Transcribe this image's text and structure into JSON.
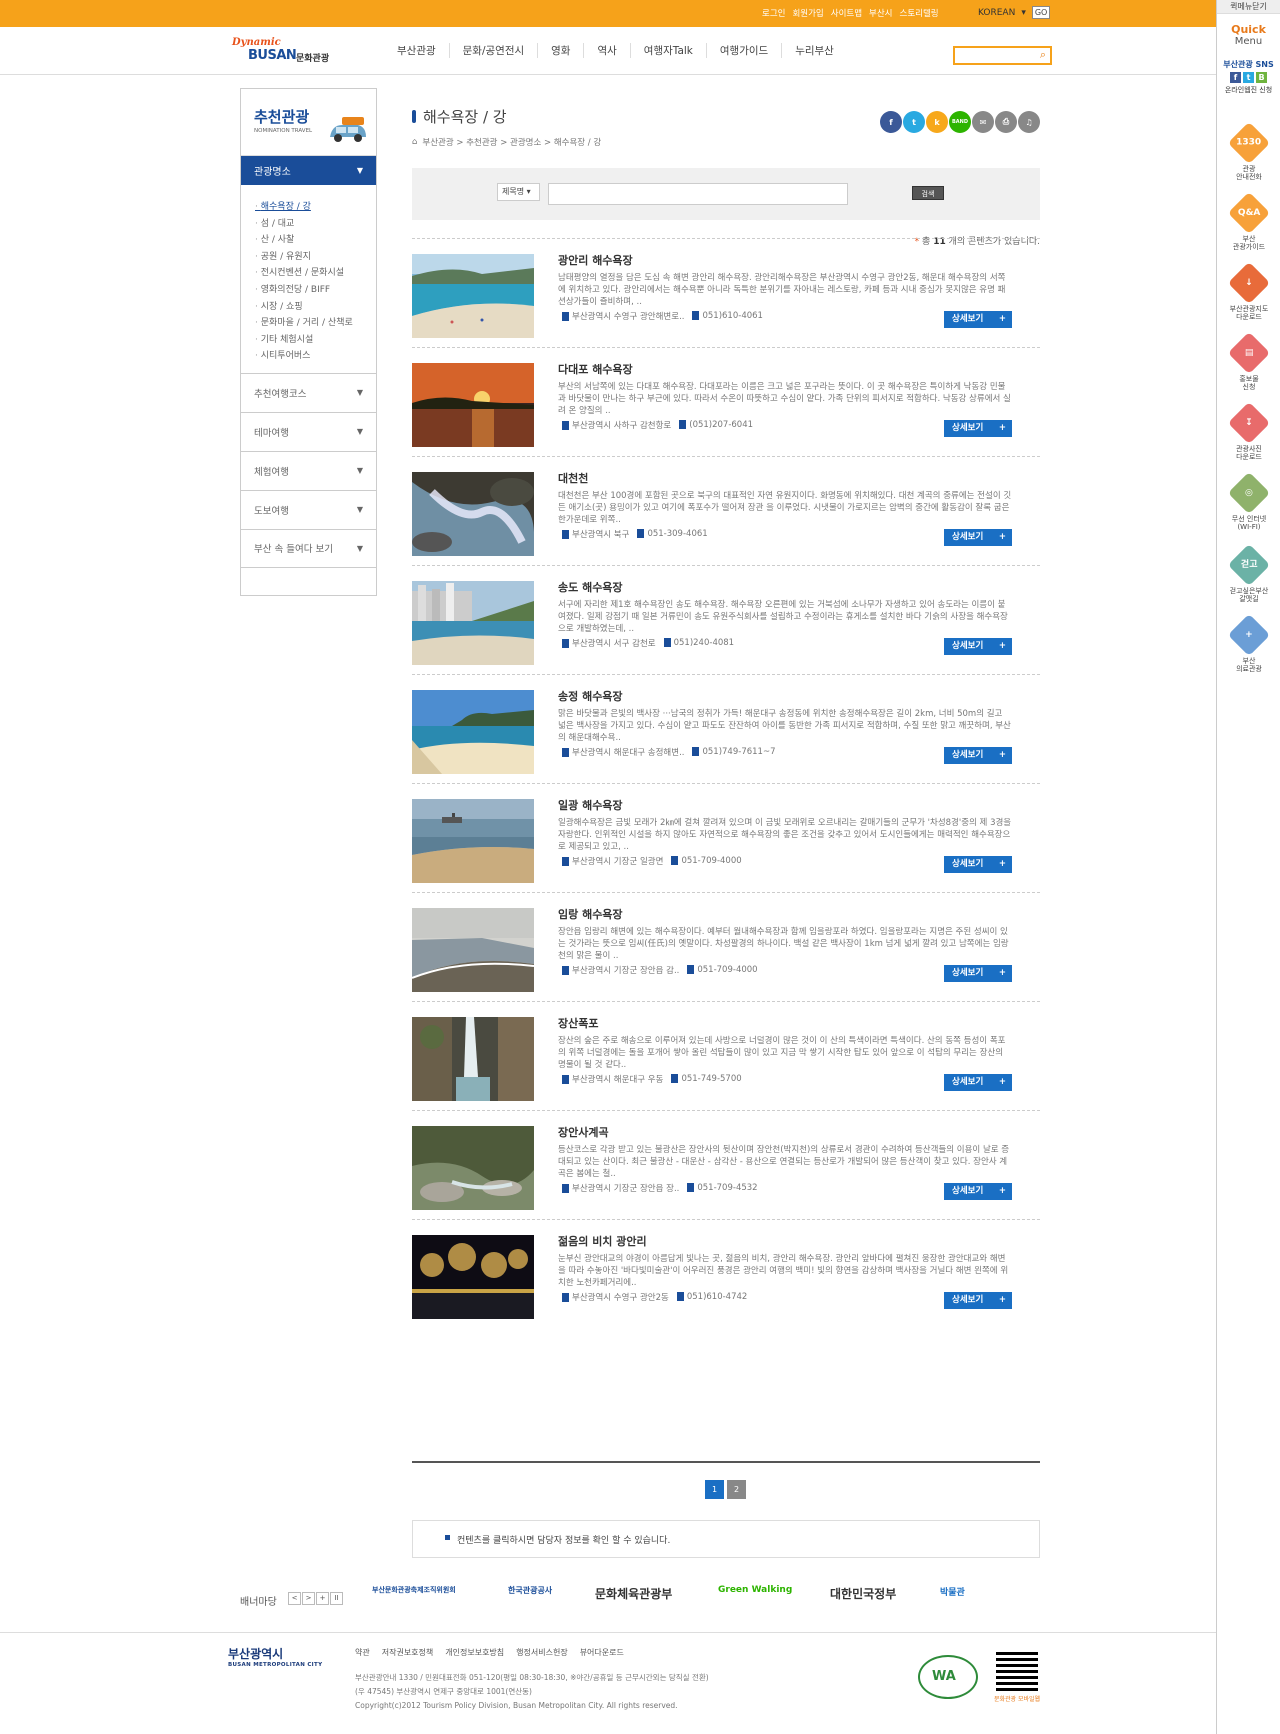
{
  "top": {
    "links": [
      "로그인",
      "회원가입",
      "사이트맵",
      "부산시",
      "스토리텔링"
    ],
    "lang": "KOREAN",
    "go": "GO"
  },
  "header": {
    "logo_dynamic": "Dynamic",
    "logo_busan": "BUSAN",
    "logo_kr": "문화관광",
    "nav": [
      "부산관광",
      "문화/공연전시",
      "영화",
      "역사",
      "여행자Talk",
      "여행가이드",
      "누리부산"
    ]
  },
  "quick": {
    "close": "퀵메뉴닫기",
    "title1": "Quick",
    "title2": "Menu",
    "sns": "부산관광 SNS",
    "news": "온라인웹진 신청",
    "items": [
      {
        "icon": "1330",
        "label1": "관광",
        "label2": "안내전화",
        "color": "#f7a13a"
      },
      {
        "icon": "Q&A",
        "label1": "부산",
        "label2": "관광가이드",
        "color": "#f7a13a"
      },
      {
        "icon": "↓",
        "label1": "부산관광지도",
        "label2": "다운로드",
        "color": "#e86b3a"
      },
      {
        "icon": "▤",
        "label1": "홍보물",
        "label2": "신청",
        "color": "#e86b6b"
      },
      {
        "icon": "↧",
        "label1": "관광사진",
        "label2": "다운로드",
        "color": "#e86b6b"
      },
      {
        "icon": "◎",
        "label1": "무선 인터넷",
        "label2": "(WI-FI)",
        "color": "#8fb26b"
      },
      {
        "icon": "걷고",
        "label1": "걷고싶은부산",
        "label2": "갈맷길",
        "color": "#6bb2a6"
      },
      {
        "icon": "+",
        "label1": "부산",
        "label2": "의료관광",
        "color": "#6b9ed6"
      }
    ]
  },
  "lnb": {
    "title": "추천관광",
    "subtitle": "NOMINATION TRAVEL",
    "active": "관광명소",
    "sub": [
      "해수욕장 / 강",
      "섬 / 대교",
      "산 / 사찰",
      "공원 / 유원지",
      "전시컨벤션 / 문화시설",
      "영화의전당 / BIFF",
      "시장 / 쇼핑",
      "문화마을 / 거리 / 산책로",
      "기타 체험시설",
      "시티투어버스"
    ],
    "groups": [
      "추천여행코스",
      "테마여행",
      "체험여행",
      "도보여행",
      "부산 속 들여다 보기"
    ]
  },
  "main": {
    "title": "해수욕장 / 강",
    "breadcrumb": "부산관광 > 추천관광 > 관광명소 > 해수욕장 / 강",
    "share": [
      "f",
      "t",
      "k",
      "BAND",
      "✉",
      "⎙",
      "♫"
    ],
    "search_select": "제목명 ▾",
    "search_btn": "검색",
    "count_pre": "총",
    "count_num": "11",
    "count_post": "개의 콘텐츠가 있습니다.",
    "more_label": "상세보기",
    "notice": "컨텐츠를 클릭하시면 담당자 정보를 확인 할 수 있습니다.",
    "pages": [
      "1",
      "2"
    ]
  },
  "items": [
    {
      "title": "광안리 해수욕장",
      "desc": "남태평양의 열정을 담은 도심 속 해변 광안리 해수욕장. 광안리해수욕장은 부산광역시 수영구 광안2동, 해운대 해수욕장의 서쪽에 위치하고 있다. 광안리에서는 해수욕뿐 아니라 독특한 분위기를 자아내는 레스토랑, 카페 등과 시내 중심가 못지않은 유명 패션상가들이 즐비하며, ..",
      "addr": "부산광역시 수영구 광안해변로..",
      "tel": "051)610-4061",
      "scene": "beach"
    },
    {
      "title": "다대포 해수욕장",
      "desc": "부산의 서남쪽에 있는 다대포 해수욕장. 다대포라는 이름은 크고 넓은 포구라는 뜻이다. 이 곳 해수욕장은 특이하게 낙동강 민물과 바닷물이 만나는 하구 부근에 있다. 따라서 수온이 따뜻하고 수심이 얕다. 가족 단위의 피서지로 적합하다. 낙동강 상류에서 실려 온 양질의 ..",
      "addr": "부산광역시 사하구 감천항로",
      "tel": "(051)207-6041",
      "scene": "sunset"
    },
    {
      "title": "대천천",
      "desc": "대천천은 부산 100경에 포함된 곳으로 북구의 대표적인 자연 유원지이다. 화명동에 위치해있다. 대천 계곡의 중류에는 전설이 깃든 애기소(곳) 용밍이가 있고 여기에 폭포수가 떨어져 장관 을 이루었다. 시냇물이 가로지르는 암벽의 중간에 활동감이 잘록 굽은 한가운데로 위쪽..",
      "addr": "부산광역시 북구",
      "tel": "051-309-4061",
      "scene": "stream"
    },
    {
      "title": "송도 해수욕장",
      "desc": "서구에 자리한 제1호 해수욕장인 송도 해수욕장. 해수욕장 오른편에 있는 거북섬에 소나무가 자생하고 있어 송도라는 이름이 붙여졌다. 일제 강점기 때 일본 거류민이 송도 유원주식회사를 설립하고 수정이라는 휴게소를 설치한 바다 기슭의 사장을 해수욕장으로 개발하였는데, ..",
      "addr": "부산광역시 서구 감천로",
      "tel": "051)240-4081",
      "scene": "city"
    },
    {
      "title": "송정 해수욕장",
      "desc": "맑은 바닷물과 은빛의 백사장 ···남국의 정취가 가득! 해운대구 송정동에 위치한 송정해수욕장은 길이 2km, 너비 50m의 길고 넓은 백사장을 가지고 있다. 수심이 얕고 파도도 잔잔하여 아이를 동반한 가족 피서지로 적합하며, 수질 또한 맑고 깨끗하며, 부산의 해운대해수욕..",
      "addr": "부산광역시 해운대구 송정해변..",
      "tel": "051)749-7611~7",
      "scene": "bay"
    },
    {
      "title": "일광 해수욕장",
      "desc": "일광해수욕장은 금빛 모래가 2㎞에 걸쳐 깔려져 있으며 이 금빛 모래위로 오르내리는 갈매기들의 군무가 '차성8경'중의 제 3경을 자랑한다. 인위적인 시설을 하지 않아도 자연적으로 해수욕장의 좋은 조건을 갖추고 있어서 도시인들에게는 매력적인 해수욕장으로 제공되고 있고, ..",
      "addr": "부산광역시 기장군 일광면",
      "tel": "051-709-4000",
      "scene": "shore"
    },
    {
      "title": "임랑 해수욕장",
      "desc": "장안읍 임랑리 해변에 있는 해수욕장이다. 예부터 월내해수욕장과 함께 임을랑포라 하였다. 임을랑포라는 지명은 주된 성씨이 있는 것가라는 뜻으로 임씨(任氏)의 옛말이다. 차성팔경의 하나이다. 백설 같은 백사장이 1km 넘게 넓게 깔려 있고 남쪽에는 임랑천의 맑은 물이 ..",
      "addr": "부산광역시 기장군 장안읍 감..",
      "tel": "051-709-4000",
      "scene": "grey"
    },
    {
      "title": "장산폭포",
      "desc": "장산의 숲은 주로 해송으로 이루어져 있는데 사방으로 너덜경이 많은 것이 이 산의 특색이라면 특색이다. 산의 동쪽 등성이 폭포의 위쪽 너덜경에는 돌을 포개어 쌓아 올린 석탑들이 많이 있고 지금 막 쌓기 시작한 탑도 있어 앞으로 이 석탑의 무리는 장산의 명물이 될 것 같다..",
      "addr": "부산광역시 해운대구 우동",
      "tel": "051-749-5700",
      "scene": "fall"
    },
    {
      "title": "장안사계곡",
      "desc": "등산코스로 각광 받고 있는 불광산은 장안사의 뒷산이며 장안천(박지천)의 상류로서 경관이 수려하여 등산객들의 이용이 날로 증대되고 있는 산이다. 최근 불광산 - 대운산 - 삼각산 - 용산으로 연결되는 등산로가 개발되어 많은 등산객이 찾고 있다. 장안사 계곡은 봄에는 철..",
      "addr": "부산광역시 기장군 장안읍 장..",
      "tel": "051-709-4532",
      "scene": "valley"
    },
    {
      "title": "젊음의 비치 광안리",
      "desc": "눈부신 광안대교의 야경이 아름답게 빛나는 곳, 젊음의 비치, 광안리 해수욕장. 광안리 앞바다에 펼쳐진 웅장한 광안대교와 해변을 따라 수놓아진 '바다빛미술관'이 어우러진 풍경은 광안리 여행의 백미! 빛의 향연을 감상하며 백사장을 거닐다 해변 왼쪽에 위치한 노천카페거리에..",
      "addr": "부산광역시 수영구 광안2동",
      "tel": "051)610-4742",
      "scene": "night"
    }
  ],
  "banners": {
    "label": "배너마당",
    "ctrl": [
      "<",
      ">",
      "+",
      "II"
    ],
    "list": [
      "부산문화관광축제조직위원회",
      "한국관광공사",
      "문화체육관광부",
      "Green Walking",
      "대한민국정부",
      "박물관"
    ]
  },
  "footer": {
    "logo": "부산광역시",
    "logo_en": "BUSAN METROPOLITAN CITY",
    "links": [
      "약관",
      "저작권보호정책",
      "개인정보보호방침",
      "행정서비스헌장",
      "뷰어다운로드"
    ],
    "addr1": "부산관광안내 1330 / 민원대표전화 051-120(평일 08:30-18:30, ※야간/공휴일 등 근무시간외는 당직실 전환)",
    "addr2": "(우 47545) 부산광역시 연제구 중앙대로 1001(연산동)",
    "copy": "Copyright(c)2012 Tourism Policy Division, Busan Metropolitan City. All rights reserved.",
    "wa": "WA",
    "qr_label": "문화관광 모바일웹"
  }
}
